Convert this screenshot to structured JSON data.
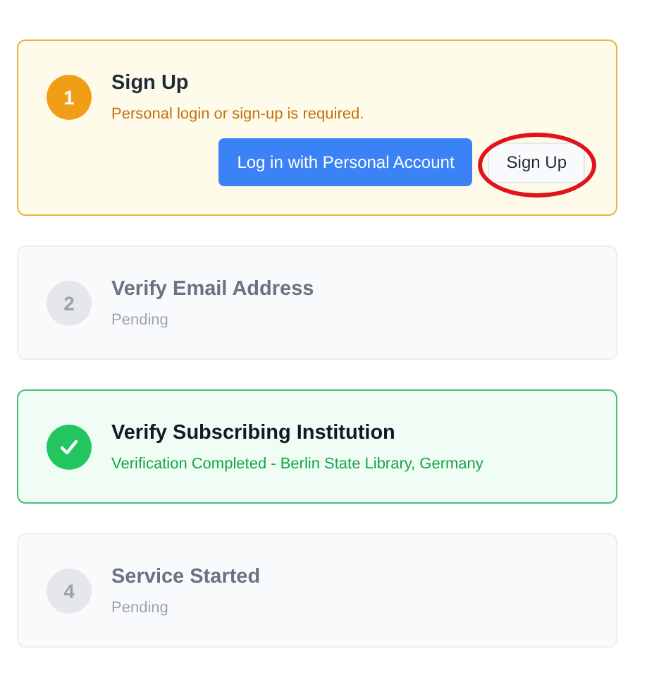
{
  "steps": [
    {
      "kind": "current",
      "number": "1",
      "title": "Sign Up",
      "subtitle": "Personal login or sign-up is required.",
      "buttons": [
        {
          "label": "Log in with Personal Account",
          "kind": "primary",
          "highlighted": false
        },
        {
          "label": "Sign Up",
          "kind": "secondary",
          "highlighted": true
        }
      ]
    },
    {
      "kind": "pending",
      "number": "2",
      "title": "Verify Email Address",
      "subtitle": "Pending"
    },
    {
      "kind": "done",
      "title": "Verify Subscribing Institution",
      "subtitle": "Verification Completed - Berlin State Library, Germany"
    },
    {
      "kind": "pending",
      "number": "4",
      "title": "Service Started",
      "subtitle": "Pending"
    }
  ]
}
